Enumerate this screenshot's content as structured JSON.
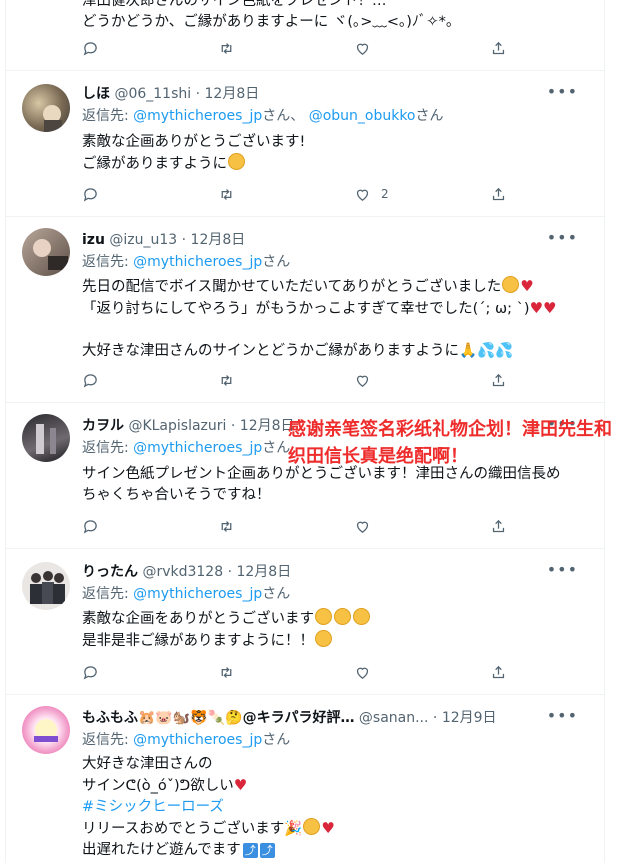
{
  "tweet0": {
    "line1": "津田健次郎さんのサイン色紙をプレゼント！…",
    "line2": "どうかどうか、ご縁がありますよーに ヾ(｡>﹏<｡)ﾉﾞ✧*。"
  },
  "tweet1": {
    "name": "しほ",
    "handle": "@06_11shi",
    "sep": "·",
    "date": "12月8日",
    "reply_prefix": "返信先:",
    "reply_to": "@mythicheroes_jp",
    "reply_and": "さん、",
    "reply_to2": "@obun_obukko",
    "reply_suffix": "さん",
    "line1": "素敵な企画ありがとうございます!",
    "line2": "ご縁がありますように",
    "like_count": "2"
  },
  "tweet2": {
    "name": "izu",
    "handle": "@izu_u13",
    "sep": "·",
    "date": "12月8日",
    "reply_prefix": "返信先:",
    "reply_to": "@mythicheroes_jp",
    "reply_suffix": "さん",
    "line1": "先日の配信でボイス聞かせていただいてありがとうございました",
    "line2": "「返り討ちにしてやろう」がもうかっこよすぎて幸せでした(´; ω; `)",
    "line3": "大好きな津田さんのサインとどうかご縁がありますように"
  },
  "tweet3": {
    "name": "カヲル",
    "handle": "@KLapislazuri",
    "sep": "·",
    "date": "12月8日",
    "reply_prefix": "返信先:",
    "reply_to": "@mythicheroes_jp",
    "reply_suffix": "さん",
    "line1": "サイン色紙プレゼント企画ありがとうございます！津田さんの織田信長め",
    "line2": "ちゃくちゃ合いそうですね！",
    "overlay1": "感谢亲笔签名彩纸礼物企划！津田先生和",
    "overlay2": "织田信长真是绝配啊！"
  },
  "tweet4": {
    "name": "りったん",
    "handle": "@rvkd3128",
    "sep": "·",
    "date": "12月8日",
    "reply_prefix": "返信先:",
    "reply_to": "@mythicheroes_jp",
    "reply_suffix": "さん",
    "line1": "素敵な企画をありがとうございます",
    "line2": "是非是非ご縁がありますように！！"
  },
  "tweet5": {
    "name": "もふもふ🐹🐷🐿️🐯🍡🤔@キラパラ好評…",
    "handle": "@sanan...",
    "sep": "·",
    "date": "12月9日",
    "reply_prefix": "返信先:",
    "reply_to": "@mythicheroes_jp",
    "reply_suffix": "さん",
    "line1": "大好きな津田さんの",
    "line2": "サインᕦ(ò_óˇ)ᕤ欲しい",
    "hashtag": "#ミシックヒーローズ",
    "line4": "リリースおめでとうございます",
    "line5": "出遅れたけど遊んでます"
  },
  "colors": {
    "link": "#1d9bf0",
    "muted": "#536471",
    "text": "#0f1419",
    "overlay_text": "#ee2c2c",
    "heart": "#d9263a"
  }
}
